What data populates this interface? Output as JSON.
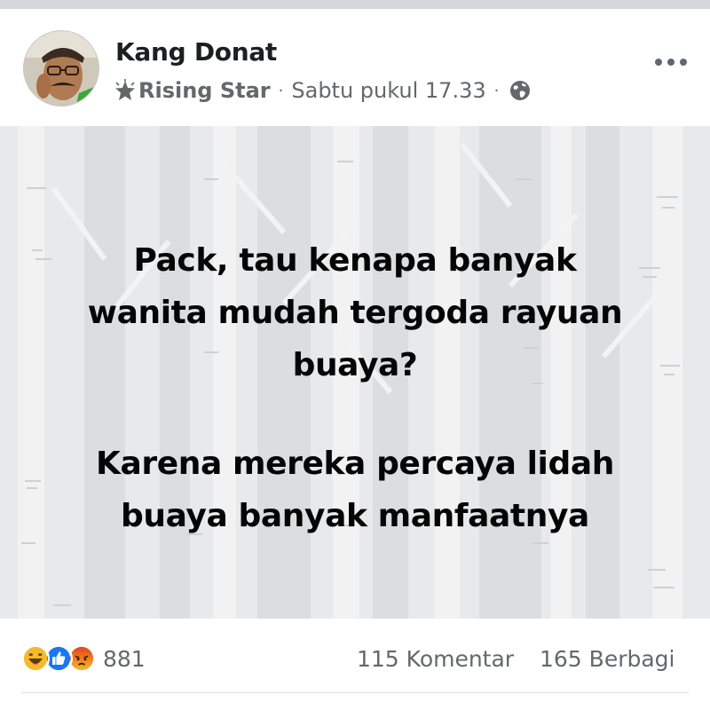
{
  "post": {
    "author": "Kang Donat",
    "badge_label": "Rising Star",
    "timestamp": "Sabtu pukul 17.33",
    "separator": "·",
    "text_paragraph_1_lines": [
      "Pack, tau kenapa banyak",
      "wanita mudah tergoda rayuan",
      "buaya?"
    ],
    "text_paragraph_2_lines": [
      "Karena mereka percaya lidah",
      "buaya banyak manfaatnya"
    ]
  },
  "reactions": {
    "icons": [
      "haha-icon",
      "like-icon",
      "angry-icon"
    ],
    "count": "881"
  },
  "stats": {
    "comments": "115 Komentar",
    "shares": "165 Berbagi"
  },
  "colors": {
    "text_primary": "#050505",
    "text_secondary": "#65676b",
    "like_blue": "#1877f2",
    "haha_yellow": "#f7b928",
    "angry_orange": "#e9710f",
    "card_background": "#e9eaeb"
  }
}
